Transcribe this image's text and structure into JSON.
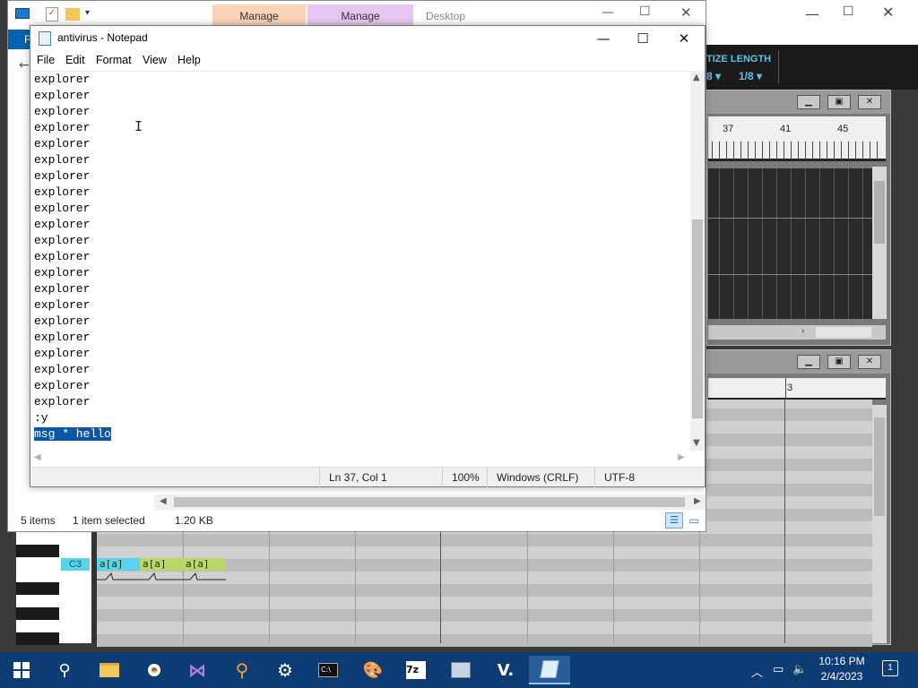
{
  "explorer": {
    "ribbon_tabs": [
      "Manage",
      "Manage",
      "Desktop"
    ],
    "status_items": "5 items",
    "status_selected": "1 item selected",
    "status_size": "1.20 KB",
    "blue_tab": "F"
  },
  "daw": {
    "toolbar_label": "TIZE LENGTH",
    "toolbar_quant": "8 ▾",
    "toolbar_length": "1/8 ▾",
    "ruler_top": [
      "37",
      "41",
      "45"
    ],
    "ruler_bottom": "3",
    "key_label": "C3",
    "notes": [
      "a[a]",
      "a[a]",
      "a[a]"
    ],
    "colors": {
      "note_cyan": "#5bd3ec",
      "note_green": "#b8d86a",
      "toolbar_text": "#5bc2e7"
    }
  },
  "notepad": {
    "title": "antivirus - Notepad",
    "menu": [
      "File",
      "Edit",
      "Format",
      "View",
      "Help"
    ],
    "lines": [
      "explorer",
      "explorer",
      "explorer",
      "explorer",
      "explorer",
      "explorer",
      "explorer",
      "explorer",
      "explorer",
      "explorer",
      "explorer",
      "explorer",
      "explorer",
      "explorer",
      "explorer",
      "explorer",
      "explorer",
      "explorer",
      "explorer",
      "explorer",
      "explorer",
      ":y"
    ],
    "selected_line": "msg * hello",
    "status": {
      "position": "Ln 37, Col 1",
      "zoom": "100%",
      "line_ending": "Windows (CRLF)",
      "encoding": "UTF-8"
    },
    "selection_color": "#0a57a8"
  },
  "taskbar": {
    "time": "10:16 PM",
    "date": "2/4/2023",
    "notification_count": "1",
    "apps": [
      "start-icon",
      "search-icon",
      "file-explorer-icon",
      "chrome-icon",
      "visual-studio-icon",
      "search-tool-icon",
      "settings-icon",
      "terminal-icon",
      "paint-icon",
      "7zip-icon",
      "network-icon",
      "vim-icon",
      "notepad-icon"
    ]
  }
}
